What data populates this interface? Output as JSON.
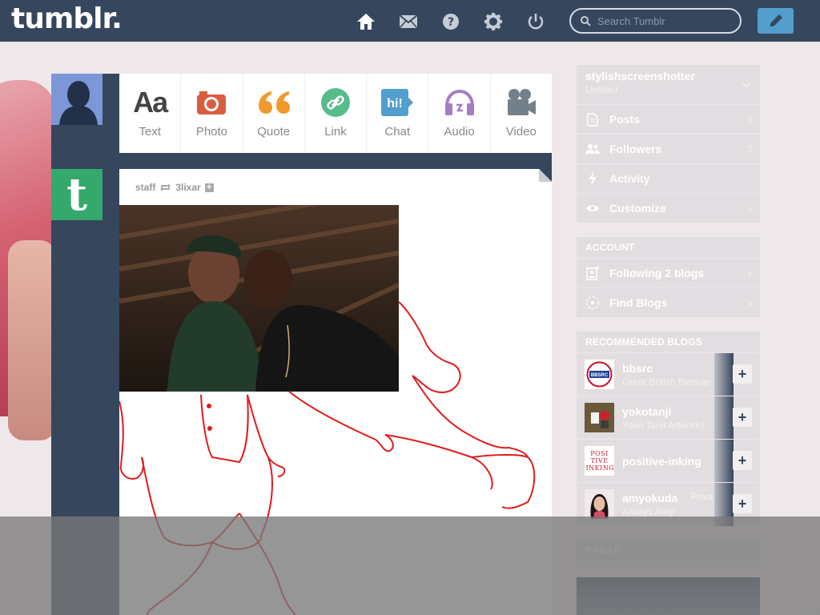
{
  "header": {
    "logo": "tumblr.",
    "search_placeholder": "Search Tumblr",
    "nav": [
      "home-icon",
      "mail-icon",
      "help-icon",
      "gear-icon",
      "power-icon"
    ],
    "compose_icon": "pencil-icon"
  },
  "post_types": [
    {
      "label": "Text",
      "icon": "text-icon",
      "color": "#444444"
    },
    {
      "label": "Photo",
      "icon": "camera-icon",
      "color": "#d95e40"
    },
    {
      "label": "Quote",
      "icon": "quote-icon",
      "color": "#f2992e"
    },
    {
      "label": "Link",
      "icon": "link-icon",
      "color": "#56bc8a"
    },
    {
      "label": "Chat",
      "icon": "chat-icon",
      "color": "#529ecc"
    },
    {
      "label": "Audio",
      "icon": "headphones-icon",
      "color": "#a77dc2"
    },
    {
      "label": "Video",
      "icon": "video-camera-icon",
      "color": "#748089"
    }
  ],
  "post": {
    "author": "staff",
    "reblogged_from": "3lixar"
  },
  "sidebar": {
    "blog": {
      "name": "stylishscreenshotter",
      "subtitle": "Untitled"
    },
    "blog_items": [
      {
        "label": "Posts",
        "count": "0",
        "icon": "posts-icon"
      },
      {
        "label": "Followers",
        "count": "3",
        "icon": "followers-icon"
      },
      {
        "label": "Activity",
        "count": "",
        "icon": "activity-icon"
      },
      {
        "label": "Customize",
        "count": "",
        "icon": "eye-icon"
      }
    ],
    "account_header": "ACCOUNT",
    "account_items": [
      {
        "label": "Following 2 blogs",
        "icon": "following-icon"
      },
      {
        "label": "Find Blogs",
        "icon": "compass-icon"
      }
    ],
    "recommended_header": "RECOMMENDED BLOGS",
    "recommended": [
      {
        "name": "bbsrc",
        "desc": "Great British Bioscie",
        "thumb_text": "BBSRC"
      },
      {
        "name": "yokotanji",
        "desc": "Yoko Tanji Artworks",
        "thumb_text": ""
      },
      {
        "name": "positive-inking",
        "desc": "",
        "thumb_text": "POSI TIVE INKING"
      },
      {
        "name": "amyokuda",
        "desc": "Always Amy",
        "thumb_text": "",
        "extra": "Priva"
      }
    ],
    "radar_header": "RADAR"
  }
}
